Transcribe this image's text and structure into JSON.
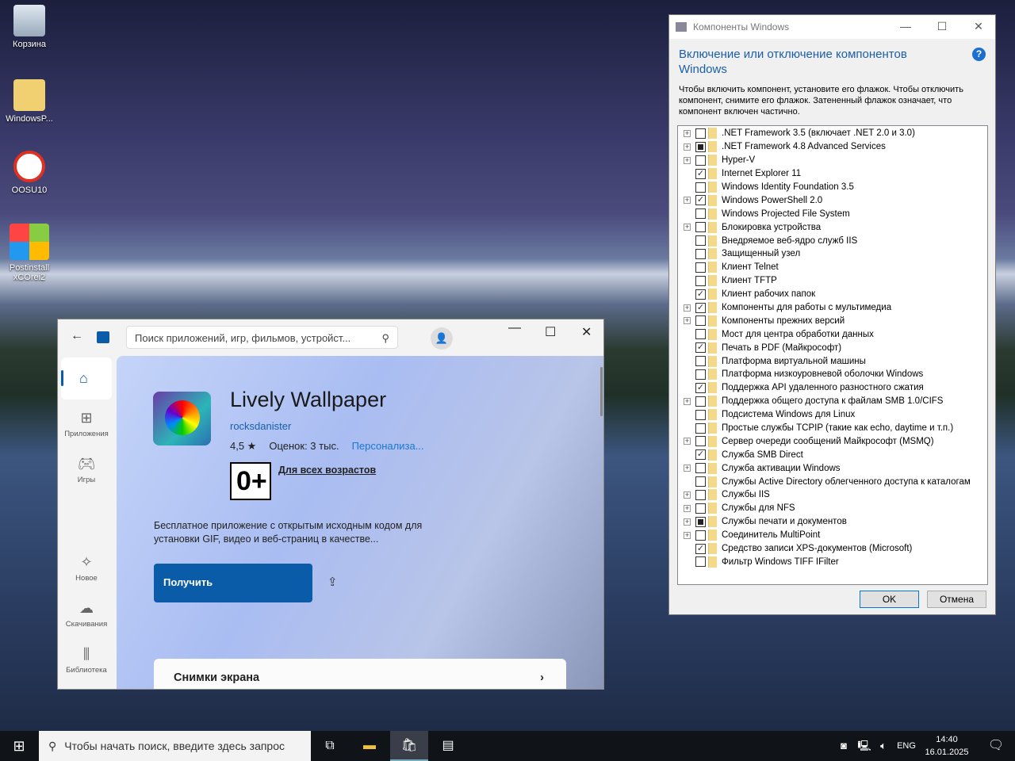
{
  "desktop": {
    "icons": [
      "Корзина",
      "WindowsP...",
      "OOSU10",
      "Postinstall xCOrei2"
    ]
  },
  "features": {
    "title": "Компоненты Windows",
    "heading": "Включение или отключение компонентов Windows",
    "description": "Чтобы включить компонент, установите его флажок. Чтобы отключить компонент, снимите его флажок. Затененный флажок означает, что компонент включен частично.",
    "ok": "OK",
    "cancel": "Отмена",
    "items": [
      {
        "label": ".NET Framework 3.5 (включает .NET 2.0 и 3.0)",
        "expand": true,
        "state": "none"
      },
      {
        "label": ".NET Framework 4.8 Advanced Services",
        "expand": true,
        "state": "partial"
      },
      {
        "label": "Hyper-V",
        "expand": true,
        "state": "none"
      },
      {
        "label": "Internet Explorer 11",
        "expand": false,
        "state": "checked"
      },
      {
        "label": "Windows Identity Foundation 3.5",
        "expand": false,
        "state": "none"
      },
      {
        "label": "Windows PowerShell 2.0",
        "expand": true,
        "state": "checked"
      },
      {
        "label": "Windows Projected File System",
        "expand": false,
        "state": "none"
      },
      {
        "label": "Блокировка устройства",
        "expand": true,
        "state": "none"
      },
      {
        "label": "Внедряемое веб-ядро служб IIS",
        "expand": false,
        "state": "none"
      },
      {
        "label": "Защищенный узел",
        "expand": false,
        "state": "none"
      },
      {
        "label": "Клиент Telnet",
        "expand": false,
        "state": "none"
      },
      {
        "label": "Клиент TFTP",
        "expand": false,
        "state": "none"
      },
      {
        "label": "Клиент рабочих папок",
        "expand": false,
        "state": "checked"
      },
      {
        "label": "Компоненты для работы с мультимедиа",
        "expand": true,
        "state": "checked"
      },
      {
        "label": "Компоненты прежних версий",
        "expand": true,
        "state": "none"
      },
      {
        "label": "Мост для центра обработки данных",
        "expand": false,
        "state": "none"
      },
      {
        "label": "Печать в PDF (Майкрософт)",
        "expand": false,
        "state": "checked"
      },
      {
        "label": "Платформа виртуальной машины",
        "expand": false,
        "state": "none"
      },
      {
        "label": "Платформа низкоуровневой оболочки Windows",
        "expand": false,
        "state": "none"
      },
      {
        "label": "Поддержка API удаленного разностного сжатия",
        "expand": false,
        "state": "checked"
      },
      {
        "label": "Поддержка общего доступа к файлам SMB 1.0/CIFS",
        "expand": true,
        "state": "none"
      },
      {
        "label": "Подсистема Windows для Linux",
        "expand": false,
        "state": "none"
      },
      {
        "label": "Простые службы TCPIP (такие как echo, daytime и т.п.)",
        "expand": false,
        "state": "none"
      },
      {
        "label": "Сервер очереди сообщений Майкрософт (MSMQ)",
        "expand": true,
        "state": "none"
      },
      {
        "label": "Служба SMB Direct",
        "expand": false,
        "state": "checked"
      },
      {
        "label": "Служба активации Windows",
        "expand": true,
        "state": "none"
      },
      {
        "label": "Службы Active Directory облегченного доступа к каталогам",
        "expand": false,
        "state": "none"
      },
      {
        "label": "Службы IIS",
        "expand": true,
        "state": "none"
      },
      {
        "label": "Службы для NFS",
        "expand": true,
        "state": "none"
      },
      {
        "label": "Службы печати и документов",
        "expand": true,
        "state": "partial"
      },
      {
        "label": "Соединитель MultiPoint",
        "expand": true,
        "state": "none"
      },
      {
        "label": "Средство записи XPS-документов (Microsoft)",
        "expand": false,
        "state": "checked"
      },
      {
        "label": "Фильтр Windows TIFF IFilter",
        "expand": false,
        "state": "none"
      }
    ]
  },
  "store": {
    "search_placeholder": "Поиск приложений, игр, фильмов, устройст...",
    "nav": [
      "Приложения",
      "Игры",
      "Новое",
      "Скачивания",
      "Библиотека"
    ],
    "app_name": "Lively Wallpaper",
    "publisher": "rocksdanister",
    "rating": "4,5 ★",
    "reviews": "Оценок: 3 тыс.",
    "category": "Персонализа...",
    "age_rating": "0+",
    "age_label": "Для всех возрастов",
    "description": "Бесплатное приложение с открытым исходным кодом для установки GIF, видео и веб-страниц в качестве...",
    "get_button": "Получить",
    "screenshots": "Снимки экрана"
  },
  "taskbar": {
    "search": "Чтобы начать поиск, введите здесь запрос",
    "lang": "ENG",
    "time": "14:40",
    "date": "16.01.2025"
  }
}
